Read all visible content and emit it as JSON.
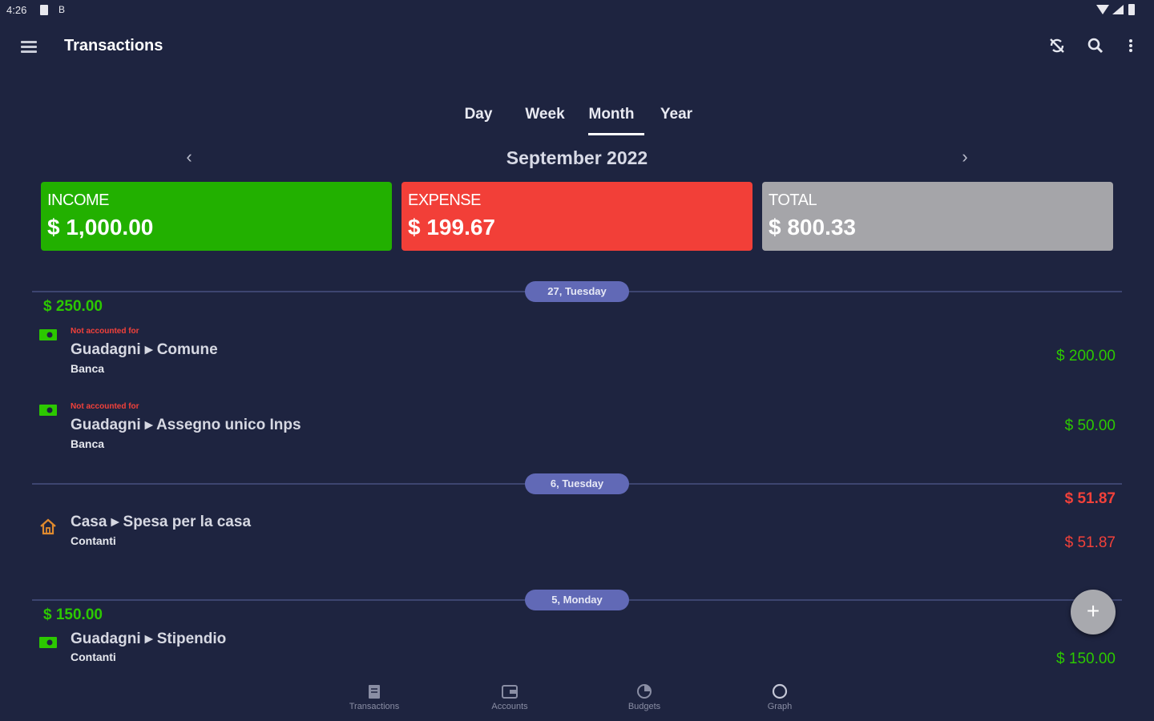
{
  "status_bar": {
    "time": "4:26",
    "icon_b": "B"
  },
  "app_bar": {
    "title": "Transactions",
    "menu_icon": "hamburger-icon",
    "actions": [
      "sync-off-icon",
      "search-icon",
      "more-vert-icon"
    ]
  },
  "period_tabs": [
    {
      "label": "Day",
      "selected": false
    },
    {
      "label": "Week",
      "selected": false
    },
    {
      "label": "Month",
      "selected": true
    },
    {
      "label": "Year",
      "selected": false
    }
  ],
  "month_nav": {
    "label": "September 2022",
    "prev": "‹",
    "next": "›"
  },
  "summary": {
    "income": {
      "label": "INCOME",
      "amount": "$ 1,000.00",
      "color": "#22b000"
    },
    "expense": {
      "label": "EXPENSE",
      "amount": "$ 199.67",
      "color": "#f23f38"
    },
    "total": {
      "label": "TOTAL",
      "amount": "$ 800.33",
      "color": "#a5a5a9"
    }
  },
  "days": [
    {
      "label": "27, Tuesday",
      "total": "$ 250.00",
      "transactions": [
        {
          "note": "Not accounted for",
          "category": "Guadagni ▸ Comune",
          "account": "Banca",
          "amount": "$ 200.00",
          "type": "income",
          "icon": "cash-icon"
        },
        {
          "note": "Not accounted for",
          "category": "Guadagni ▸ Assegno unico Inps",
          "account": "Banca",
          "amount": "$ 50.00",
          "type": "income",
          "icon": "cash-icon"
        }
      ]
    },
    {
      "label": "6, Tuesday",
      "total": "$ 51.87",
      "transactions": [
        {
          "note": "",
          "category": "Casa ▸ Spesa per la casa",
          "account": "Contanti",
          "amount": "$ 51.87",
          "type": "expense",
          "icon": "home-icon"
        }
      ]
    },
    {
      "label": "5, Monday",
      "total": "$ 150.00",
      "transactions": [
        {
          "note": "",
          "category": "Guadagni ▸ Stipendio",
          "account": "Contanti",
          "amount": "$ 150.00",
          "type": "income",
          "icon": "cash-icon"
        }
      ]
    }
  ],
  "fab": {
    "label": "+"
  },
  "bottom_nav": [
    {
      "label": "Transactions",
      "icon": "transactions-icon"
    },
    {
      "label": "Accounts",
      "icon": "accounts-icon"
    },
    {
      "label": "Budgets",
      "icon": "budgets-icon"
    },
    {
      "label": "Graph",
      "icon": "graph-icon"
    }
  ],
  "colors": {
    "background": "#1e2440",
    "income": "#2cc800",
    "expense": "#f2413a",
    "day_pill": "#6169b6"
  }
}
